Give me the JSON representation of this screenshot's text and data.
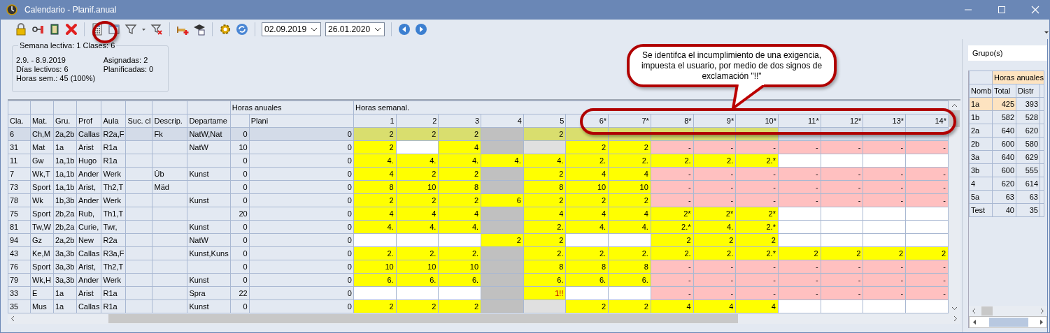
{
  "window": {
    "title": "Calendario - Planif.anual"
  },
  "toolbar": {
    "start_date": "02.09.2019",
    "end_date": "26.01.2020"
  },
  "week_info": {
    "legend": "Semana lectiva: 1  Clases: 6",
    "dates": "2.9. - 8.9.2019",
    "days": "Días lectivos: 6",
    "hours": "Horas sem.: 45 (100%)",
    "assigned": "Asignadas: 2",
    "planned": "Planificadas: 0"
  },
  "callout": "Se identifca el incumplimiento de una exigencia, impuesta el usuario, por medio de dos signos de exclamación \"!!\"",
  "table": {
    "annual_group": "Horas anuales",
    "weekly_group": "Horas semanal.",
    "columns": [
      "Cla.",
      "Mat.",
      "Gru.",
      "Prof",
      "Aula",
      "Suc. cl",
      "Descrip.",
      "Departame",
      "",
      "Plani"
    ],
    "week_columns": [
      "1",
      "2",
      "3",
      "4",
      "5",
      "6*",
      "7*",
      "8*",
      "9*",
      "10*",
      "11*",
      "12*",
      "13*",
      "14*"
    ],
    "rows": [
      {
        "selected": true,
        "cells": [
          "6",
          "Ch,M",
          "2a,2b",
          "Callas",
          "R2a,F",
          "",
          "Fk",
          "NatW,Nat",
          "0",
          "0"
        ],
        "week": [
          {
            "text": "2",
            "color": "#d9de6e"
          },
          {
            "text": "2",
            "color": "#d9de6e"
          },
          {
            "text": "2",
            "color": "#d9de6e"
          },
          {
            "color": "#c0c0c0"
          },
          {
            "text": "2",
            "color": "#d9de6e"
          },
          {
            "color": "#d9de6e"
          },
          {
            "color": "#d9de6e"
          },
          {
            "color": "#d9de6e"
          },
          {
            "color": "#d9de6e"
          },
          {
            "color": "#d9de6e"
          },
          {
            "color": "#d3dbe8"
          },
          {
            "color": "#d3dbe8"
          },
          {
            "color": "#d3dbe8"
          },
          {
            "color": "#d3dbe8"
          }
        ]
      },
      {
        "selected": false,
        "cells": [
          "31",
          "Mat",
          "1a",
          "Arist",
          "R1a",
          "",
          "",
          "NatW",
          "10",
          "0"
        ],
        "week": [
          {
            "text": "2",
            "color": "#ffff00"
          },
          {
            "color": "#ffffff"
          },
          {
            "text": "4",
            "color": "#ffff00"
          },
          {
            "color": "#c0c0c0"
          },
          {
            "color": "#e0e0e0"
          },
          {
            "text": "2",
            "color": "#ffff00"
          },
          {
            "text": "2",
            "color": "#ffff00"
          },
          {
            "text": "-",
            "color": "#ffc0c0"
          },
          {
            "text": "-",
            "color": "#ffc0c0"
          },
          {
            "text": "-",
            "color": "#ffc0c0"
          },
          {
            "text": "-",
            "color": "#ffc0c0"
          },
          {
            "text": "-",
            "color": "#ffc0c0"
          },
          {
            "text": "-",
            "color": "#ffc0c0"
          },
          {
            "text": "-",
            "color": "#ffc0c0"
          }
        ]
      },
      {
        "selected": false,
        "cells": [
          "11",
          "Gw",
          "1a,1b",
          "Hugo",
          "R1a",
          "",
          "",
          "",
          "0",
          "0"
        ],
        "week": [
          {
            "text": "4.",
            "color": "#ffff00"
          },
          {
            "text": "4.",
            "color": "#ffff00"
          },
          {
            "text": "4.",
            "color": "#ffff00"
          },
          {
            "text": "4.",
            "color": "#ffff00"
          },
          {
            "text": "4.",
            "color": "#ffff00"
          },
          {
            "text": "2.",
            "color": "#ffff00"
          },
          {
            "text": "2.",
            "color": "#ffff00"
          },
          {
            "text": "2.",
            "color": "#ffff00"
          },
          {
            "text": "2.",
            "color": "#ffff00"
          },
          {
            "text": "2.*",
            "color": "#ffff00"
          },
          {
            "color": "#ffffff"
          },
          {
            "color": "#ffffff"
          },
          {
            "color": "#ffffff"
          },
          {
            "color": "#ffffff"
          }
        ]
      },
      {
        "selected": false,
        "cells": [
          "7",
          "Wk,T",
          "1a,1b",
          "Ander",
          "Werk",
          "",
          "Üb",
          "Kunst",
          "0",
          "0"
        ],
        "week": [
          {
            "text": "4",
            "color": "#ffff00"
          },
          {
            "text": "2",
            "color": "#ffff00"
          },
          {
            "text": "2",
            "color": "#ffff00"
          },
          {
            "color": "#c0c0c0"
          },
          {
            "text": "2",
            "color": "#ffff00"
          },
          {
            "text": "4",
            "color": "#ffff00"
          },
          {
            "text": "4",
            "color": "#ffff00"
          },
          {
            "text": "-",
            "color": "#ffc0c0"
          },
          {
            "text": "-",
            "color": "#ffc0c0"
          },
          {
            "text": "-",
            "color": "#ffc0c0"
          },
          {
            "text": "-",
            "color": "#ffc0c0"
          },
          {
            "text": "-",
            "color": "#ffc0c0"
          },
          {
            "text": "-",
            "color": "#ffc0c0"
          },
          {
            "text": "-",
            "color": "#ffc0c0"
          }
        ]
      },
      {
        "selected": false,
        "cells": [
          "73",
          "Sport",
          "1a,1b",
          "Arist,",
          "Th2,T",
          "",
          "Mäd",
          "",
          "0",
          "0"
        ],
        "week": [
          {
            "text": "8",
            "color": "#ffff00"
          },
          {
            "text": "10",
            "color": "#ffff00"
          },
          {
            "text": "8",
            "color": "#ffff00"
          },
          {
            "color": "#c0c0c0"
          },
          {
            "text": "8",
            "color": "#ffff00"
          },
          {
            "text": "10",
            "color": "#ffff00"
          },
          {
            "text": "10",
            "color": "#ffff00"
          },
          {
            "text": "-",
            "color": "#ffc0c0"
          },
          {
            "text": "-",
            "color": "#ffc0c0"
          },
          {
            "text": "-",
            "color": "#ffc0c0"
          },
          {
            "text": "-",
            "color": "#ffc0c0"
          },
          {
            "text": "-",
            "color": "#ffc0c0"
          },
          {
            "text": "-",
            "color": "#ffc0c0"
          },
          {
            "text": "-",
            "color": "#ffc0c0"
          }
        ]
      },
      {
        "selected": false,
        "cells": [
          "78",
          "Wk",
          "1b,3b",
          "Ander",
          "Werk",
          "",
          "",
          "Kunst",
          "0",
          "0"
        ],
        "week": [
          {
            "text": "2",
            "color": "#ffff00"
          },
          {
            "text": "2",
            "color": "#ffff00"
          },
          {
            "text": "2",
            "color": "#ffff00"
          },
          {
            "text": "6",
            "color": "#ffff00"
          },
          {
            "text": "2",
            "color": "#ffff00"
          },
          {
            "text": "2",
            "color": "#ffff00"
          },
          {
            "text": "2",
            "color": "#ffff00"
          },
          {
            "text": "-",
            "color": "#ffc0c0"
          },
          {
            "text": "-",
            "color": "#ffc0c0"
          },
          {
            "text": "-",
            "color": "#ffc0c0"
          },
          {
            "text": "-",
            "color": "#ffc0c0"
          },
          {
            "text": "-",
            "color": "#ffc0c0"
          },
          {
            "text": "-",
            "color": "#ffc0c0"
          },
          {
            "text": "-",
            "color": "#ffc0c0"
          }
        ]
      },
      {
        "selected": false,
        "cells": [
          "75",
          "Sport",
          "2b,2a",
          "Rub,",
          "Th1,T",
          "",
          "",
          "",
          "20",
          "0"
        ],
        "week": [
          {
            "text": "4",
            "color": "#ffff00"
          },
          {
            "text": "4",
            "color": "#ffff00"
          },
          {
            "text": "4",
            "color": "#ffff00"
          },
          {
            "color": "#c0c0c0"
          },
          {
            "text": "4",
            "color": "#ffff00"
          },
          {
            "text": "4",
            "color": "#ffff00"
          },
          {
            "text": "4",
            "color": "#ffff00"
          },
          {
            "text": "2*",
            "color": "#ffff00"
          },
          {
            "text": "2*",
            "color": "#ffff00"
          },
          {
            "text": "2*",
            "color": "#ffff00"
          },
          {
            "color": "#ffffff"
          },
          {
            "color": "#ffffff"
          },
          {
            "color": "#ffffff"
          },
          {
            "color": "#ffffff"
          }
        ]
      },
      {
        "selected": false,
        "cells": [
          "81",
          "Tw,W",
          "2b,2a",
          "Curie,",
          "Twr,",
          "",
          "",
          "Kunst",
          "0",
          "0"
        ],
        "week": [
          {
            "text": "4.",
            "color": "#ffff00"
          },
          {
            "text": "4.",
            "color": "#ffff00"
          },
          {
            "text": "4.",
            "color": "#ffff00"
          },
          {
            "color": "#c0c0c0"
          },
          {
            "text": "2.",
            "color": "#ffff00"
          },
          {
            "text": "4.",
            "color": "#ffff00"
          },
          {
            "text": "4.",
            "color": "#ffff00"
          },
          {
            "text": "2.*",
            "color": "#ffff00"
          },
          {
            "text": "4.",
            "color": "#ffff00"
          },
          {
            "text": "2.*",
            "color": "#ffff00"
          },
          {
            "color": "#ffffff"
          },
          {
            "color": "#ffffff"
          },
          {
            "color": "#ffffff"
          },
          {
            "color": "#ffffff"
          }
        ]
      },
      {
        "selected": false,
        "cells": [
          "94",
          "Gz",
          "2a,2b",
          "New",
          "R2a",
          "",
          "",
          "NatW",
          "0",
          "0"
        ],
        "week": [
          {
            "color": "#ffffff"
          },
          {
            "color": "#ffffff"
          },
          {
            "color": "#ffffff"
          },
          {
            "text": "2",
            "color": "#ffff00"
          },
          {
            "text": "2",
            "color": "#ffff00"
          },
          {
            "color": "#ffffff"
          },
          {
            "color": "#ffffff"
          },
          {
            "text": "2",
            "color": "#ffff00"
          },
          {
            "text": "2",
            "color": "#ffff00"
          },
          {
            "text": "2",
            "color": "#ffff00"
          },
          {
            "color": "#ffffff"
          },
          {
            "color": "#ffffff"
          },
          {
            "color": "#ffffff"
          },
          {
            "color": "#ffffff"
          }
        ]
      },
      {
        "selected": false,
        "cells": [
          "43",
          "Ke,M",
          "3a,3b",
          "Callas",
          "R3a,F",
          "",
          "",
          "Kunst,Kuns",
          "0",
          "0"
        ],
        "week": [
          {
            "text": "2.",
            "color": "#ffff00"
          },
          {
            "text": "2.",
            "color": "#ffff00"
          },
          {
            "text": "2.",
            "color": "#ffff00"
          },
          {
            "color": "#c0c0c0"
          },
          {
            "text": "2.",
            "color": "#ffff00"
          },
          {
            "text": "2.",
            "color": "#ffff00"
          },
          {
            "text": "2.",
            "color": "#ffff00"
          },
          {
            "text": "2.",
            "color": "#ffff00"
          },
          {
            "text": "2.",
            "color": "#ffff00"
          },
          {
            "text": "2.*",
            "color": "#ffff00"
          },
          {
            "text": "2",
            "color": "#ffff00"
          },
          {
            "text": "2",
            "color": "#ffff00"
          },
          {
            "text": "2",
            "color": "#ffff00"
          },
          {
            "text": "2",
            "color": "#ffff00"
          }
        ]
      },
      {
        "selected": false,
        "cells": [
          "76",
          "Sport",
          "3a,3b",
          "Arist,",
          "Th2,T",
          "",
          "",
          "",
          "0",
          "0"
        ],
        "week": [
          {
            "text": "10",
            "color": "#ffff00"
          },
          {
            "text": "10",
            "color": "#ffff00"
          },
          {
            "text": "10",
            "color": "#ffff00"
          },
          {
            "color": "#c0c0c0"
          },
          {
            "text": "8",
            "color": "#ffff00"
          },
          {
            "text": "8",
            "color": "#ffff00"
          },
          {
            "text": "8",
            "color": "#ffff00"
          },
          {
            "text": "-",
            "color": "#ffc0c0"
          },
          {
            "text": "-",
            "color": "#ffc0c0"
          },
          {
            "text": "-",
            "color": "#ffc0c0"
          },
          {
            "text": "-",
            "color": "#ffc0c0"
          },
          {
            "text": "-",
            "color": "#ffc0c0"
          },
          {
            "text": "-",
            "color": "#ffc0c0"
          },
          {
            "text": "-",
            "color": "#ffc0c0"
          }
        ]
      },
      {
        "selected": false,
        "cells": [
          "79",
          "Wk,H",
          "3a,3b",
          "Ander",
          "Werk",
          "",
          "",
          "Kunst",
          "0",
          "0"
        ],
        "week": [
          {
            "text": "6.",
            "color": "#ffff00"
          },
          {
            "text": "6.",
            "color": "#ffff00"
          },
          {
            "text": "6.",
            "color": "#ffff00"
          },
          {
            "color": "#c0c0c0"
          },
          {
            "text": "6.",
            "color": "#ffff00"
          },
          {
            "text": "6.",
            "color": "#ffff00"
          },
          {
            "text": "6.",
            "color": "#ffff00"
          },
          {
            "text": "-",
            "color": "#ffc0c0"
          },
          {
            "text": "-",
            "color": "#ffc0c0"
          },
          {
            "text": "-",
            "color": "#ffc0c0"
          },
          {
            "text": "-",
            "color": "#ffc0c0"
          },
          {
            "text": "-",
            "color": "#ffc0c0"
          },
          {
            "text": "-",
            "color": "#ffc0c0"
          },
          {
            "text": "-",
            "color": "#ffc0c0"
          }
        ]
      },
      {
        "selected": false,
        "cells": [
          "33",
          "E",
          "1a",
          "Arist",
          "R1a",
          "",
          "",
          "Spra",
          "22",
          "0"
        ],
        "week": [
          {
            "color": "#ffffff"
          },
          {
            "color": "#ffffff"
          },
          {
            "color": "#ffffff"
          },
          {
            "color": "#c0c0c0"
          },
          {
            "text": "1!!",
            "color": "#ffff00",
            "kind": "alert"
          },
          {
            "color": "#ffffff"
          },
          {
            "color": "#ffffff"
          },
          {
            "text": "-",
            "color": "#ffc0c0"
          },
          {
            "text": "-",
            "color": "#ffc0c0"
          },
          {
            "text": "-",
            "color": "#ffc0c0"
          },
          {
            "text": "-",
            "color": "#ffc0c0"
          },
          {
            "text": "-",
            "color": "#ffc0c0"
          },
          {
            "text": "-",
            "color": "#ffc0c0"
          },
          {
            "text": "-",
            "color": "#ffc0c0"
          }
        ]
      },
      {
        "selected": false,
        "cells": [
          "35",
          "Mus",
          "1a",
          "Callas",
          "R1a",
          "",
          "",
          "Kunst",
          "0",
          "0"
        ],
        "week": [
          {
            "text": "2",
            "color": "#ffff00"
          },
          {
            "text": "2",
            "color": "#ffff00"
          },
          {
            "text": "2",
            "color": "#ffff00"
          },
          {
            "color": "#c0c0c0"
          },
          {
            "color": "#e0e0e0"
          },
          {
            "text": "2",
            "color": "#ffff00"
          },
          {
            "text": "2",
            "color": "#ffff00"
          },
          {
            "text": "4",
            "color": "#ffff00"
          },
          {
            "text": "4",
            "color": "#ffff00"
          },
          {
            "text": "4",
            "color": "#ffff00"
          },
          {
            "color": "#ffffff"
          },
          {
            "color": "#ffffff"
          },
          {
            "color": "#ffffff"
          },
          {
            "color": "#ffffff"
          }
        ]
      }
    ]
  },
  "side": {
    "filter": "Grupo(s)",
    "group_header": "Horas anuales",
    "columns": [
      "Nomb",
      "Total",
      "Distr"
    ],
    "rows": [
      {
        "name": "1a",
        "total": "425",
        "distr": "393",
        "selected": true
      },
      {
        "name": "1b",
        "total": "582",
        "distr": "528",
        "selected": false
      },
      {
        "name": "2a",
        "total": "640",
        "distr": "620",
        "selected": false
      },
      {
        "name": "2b",
        "total": "600",
        "distr": "580",
        "selected": false
      },
      {
        "name": "3a",
        "total": "640",
        "distr": "629",
        "selected": false
      },
      {
        "name": "3b",
        "total": "600",
        "distr": "555",
        "selected": false
      },
      {
        "name": "4",
        "total": "620",
        "distr": "614",
        "selected": false
      },
      {
        "name": "5a",
        "total": "63",
        "distr": "63",
        "selected": false
      },
      {
        "name": "Test",
        "total": "40",
        "distr": "35",
        "selected": false
      }
    ]
  }
}
